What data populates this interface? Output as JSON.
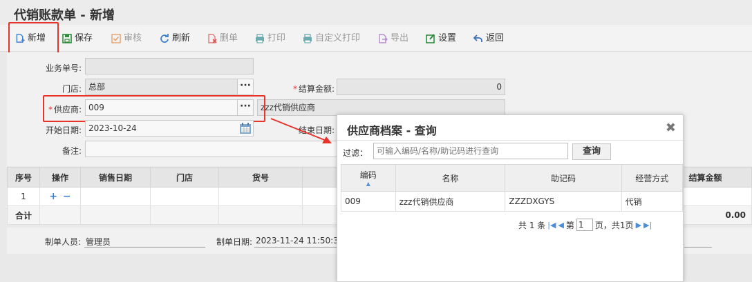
{
  "page_title": "代销账款单 - 新增",
  "toolbar": {
    "items": [
      {
        "label": "新增",
        "icon": "add-doc-icon",
        "enabled": true
      },
      {
        "label": "保存",
        "icon": "save-icon",
        "enabled": true
      },
      {
        "label": "审核",
        "icon": "check-icon",
        "enabled": false
      },
      {
        "label": "刷新",
        "icon": "refresh-icon",
        "enabled": true
      },
      {
        "label": "删单",
        "icon": "delete-doc-icon",
        "enabled": false
      },
      {
        "label": "打印",
        "icon": "print-icon",
        "enabled": false
      },
      {
        "label": "自定义打印",
        "icon": "print-icon",
        "enabled": false
      },
      {
        "label": "导出",
        "icon": "export-icon",
        "enabled": false
      },
      {
        "label": "设置",
        "icon": "settings-edit-icon",
        "enabled": true
      },
      {
        "label": "返回",
        "icon": "back-arrow-icon",
        "enabled": true
      }
    ]
  },
  "form": {
    "doc_no_label": "业务单号:",
    "doc_no_value": "",
    "store_label": "门店:",
    "store_value": "总部",
    "settle_amount_label": "结算金额:",
    "settle_amount_value": "0",
    "supplier_label": "供应商:",
    "supplier_value": "009",
    "supplier_name_value": "zzz代销供应商",
    "start_date_label": "开始日期:",
    "start_date_value": "2023-10-24",
    "end_date_label": "结束日期:",
    "remark_label": "备注:",
    "remark_value": ""
  },
  "grid": {
    "columns": [
      "序号",
      "操作",
      "销售日期",
      "门店",
      "货号",
      "结算金额"
    ],
    "row": {
      "seq": "1",
      "add": "+",
      "remove": "−"
    },
    "total_label": "合计",
    "total_amount": "0.00"
  },
  "footer": {
    "maker_label": "制单人员:",
    "maker_value": "管理员",
    "make_date_label": "制单日期:",
    "make_date_value": "2023-11-24 11:50:36"
  },
  "dialog": {
    "title": "供应商档案 - 查询",
    "close": "✖",
    "filter_label": "过滤：",
    "filter_placeholder": "可输入编码/名称/助记码进行查询",
    "query_button": "查询",
    "columns": [
      "编码",
      "名称",
      "助记码",
      "经营方式"
    ],
    "sort_indicator": "▲",
    "rows": [
      {
        "code": "009",
        "name": "zzz代销供应商",
        "mnemonic": "ZZZDXGYS",
        "mode": "代销"
      }
    ],
    "pager": {
      "total_text": "共 1 条",
      "page_prefix": "第",
      "page_value": "1",
      "page_suffix": "页，共1页"
    }
  },
  "colors": {
    "highlight": "#e8332b",
    "accent": "#3a7fd0"
  }
}
